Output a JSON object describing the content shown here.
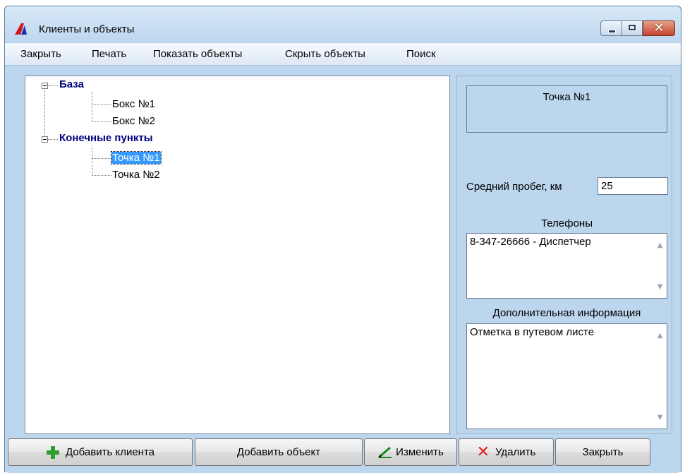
{
  "window": {
    "title": "Клиенты и объекты",
    "accent": "#bcd6ee"
  },
  "menu": {
    "items": [
      "Закрыть",
      "Печать",
      "Показать объекты",
      "Скрыть объекты",
      "Поиск"
    ]
  },
  "tree": {
    "groups": [
      {
        "label": "База",
        "expanded": true,
        "children": [
          "Бокс №1",
          "Бокс №2"
        ]
      },
      {
        "label": "Конечные пункты",
        "expanded": true,
        "children": [
          "Точка №1",
          "Точка №2"
        ]
      }
    ],
    "selected": "Точка №1"
  },
  "details": {
    "name": "Точка №1",
    "mileage_label": "Средний пробег, км",
    "mileage_value": "25",
    "phones_label": "Телефоны",
    "phones_value": "8-347-26666 - Диспетчер",
    "info_label": "Дополнительная информация",
    "info_value": "Отметка в путевом листе"
  },
  "buttons": {
    "add_client": "Добавить клиента",
    "add_object": "Добавить объект",
    "edit": "Изменить",
    "delete": "Удалить",
    "close": "Закрыть"
  },
  "icons": {
    "app": "app-logo-icon",
    "add": "plus-icon",
    "edit": "pen-icon",
    "delete": "red-x-icon"
  }
}
